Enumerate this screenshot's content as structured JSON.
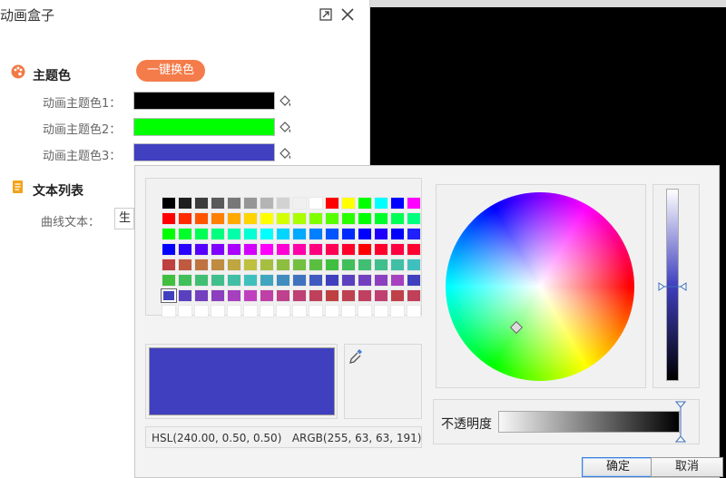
{
  "window": {
    "title": "动画盒子"
  },
  "theme_section": {
    "title": "主题色",
    "oneclick_label": "一键换色"
  },
  "theme_colors": [
    {
      "label": "动画主题色1：",
      "color": "#000000"
    },
    {
      "label": "动画主题色2：",
      "color": "#00ff00"
    },
    {
      "label": "动画主题色3：",
      "color": "#4040c0"
    }
  ],
  "text_section": {
    "title": "文本列表",
    "curve_label": "曲线文本：",
    "curve_value": "生"
  },
  "picker": {
    "selected_color": "#3f3fbf",
    "readout": "HSL(240.00, 0.50, 0.50)   ARGB(255, 63, 63, 191)",
    "opacity_label": "不透明度",
    "ok_label": "确定",
    "cancel_label": "取消",
    "palette": [
      [
        "#000000",
        "#1e1e1e",
        "#3c3c3c",
        "#5a5a5a",
        "#787878",
        "#969696",
        "#b4b4b4",
        "#d2d2d2",
        "#f0f0f0",
        "#ffffff",
        "#ff0000",
        "#ffff00",
        "#00ff00",
        "#00ffff",
        "#0000ff",
        "#ff00ff"
      ],
      [
        "#ff0000",
        "#ff2a00",
        "#ff5500",
        "#ff7f00",
        "#ffaa00",
        "#ffd400",
        "#ffff00",
        "#d4ff00",
        "#aaff00",
        "#7fff00",
        "#55ff00",
        "#2aff00",
        "#00ff00",
        "#00ff2a",
        "#00ff55",
        "#00ff7f"
      ],
      [
        "#00ff00",
        "#00ff2a",
        "#00ff55",
        "#00ff7f",
        "#00ffaa",
        "#00ffd4",
        "#00ffff",
        "#00d4ff",
        "#00aaff",
        "#007fff",
        "#0055ff",
        "#002aff",
        "#0000ff",
        "#1f00ff",
        "#0000ff",
        "#2020ff"
      ],
      [
        "#0000ff",
        "#2a00ff",
        "#5500ff",
        "#7f00ff",
        "#aa00ff",
        "#d400ff",
        "#ff00ff",
        "#ff00d4",
        "#ff00aa",
        "#ff007f",
        "#ff0055",
        "#ff002a",
        "#ff0000",
        "#ff002a",
        "#ff0040",
        "#ff0030"
      ],
      [
        "#bf4040",
        "#bf5a40",
        "#bf7340",
        "#bf8c40",
        "#bfa640",
        "#bfbf40",
        "#a6bf40",
        "#8cbf40",
        "#73bf40",
        "#5abf40",
        "#40bf40",
        "#40bf5a",
        "#40bf73",
        "#40bf8c",
        "#40bfa6",
        "#40bfbf"
      ],
      [
        "#40bf40",
        "#40bf5a",
        "#40bf73",
        "#40bf8c",
        "#40bfa6",
        "#40bfbf",
        "#40a6bf",
        "#408cbf",
        "#4073bf",
        "#405abf",
        "#4040bf",
        "#5a40bf",
        "#7340bf",
        "#8c40bf",
        "#a640bf",
        "#4040bf"
      ],
      [
        "#4040bf",
        "#5a40bf",
        "#7340bf",
        "#8c40bf",
        "#a640bf",
        "#bf40bf",
        "#bf40a6",
        "#bf408c",
        "#bf4073",
        "#bf405a",
        "#bf4040",
        "#bf4050",
        "#bf4060",
        "#bf4070",
        "#bf4048",
        "#bf4058"
      ],
      [
        "#ffffff",
        "#ffffff",
        "#ffffff",
        "#ffffff",
        "#ffffff",
        "#ffffff",
        "#ffffff",
        "#ffffff",
        "#ffffff",
        "#ffffff",
        "#ffffff",
        "#ffffff",
        "#ffffff",
        "#ffffff",
        "#ffffff",
        "#ffffff"
      ]
    ],
    "selected_cell": [
      6,
      0
    ]
  },
  "icons": {
    "restore": "restore-icon",
    "close": "close-icon",
    "palette": "palette-icon",
    "list": "document-list-icon",
    "bucket": "paint-bucket-icon",
    "eyedropper": "eyedropper-icon"
  }
}
